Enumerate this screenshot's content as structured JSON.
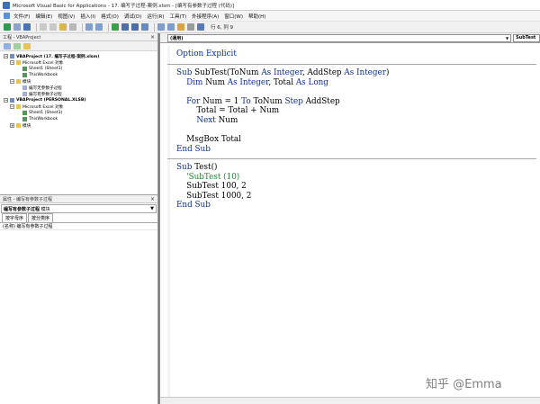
{
  "window": {
    "title": "Microsoft Visual Basic for Applications - 17. 编写子过程-案例.xlsm - [编写有参数子过程 (代码)]"
  },
  "menu": [
    "文件(F)",
    "编辑(E)",
    "视图(V)",
    "插入(I)",
    "格式(O)",
    "调试(D)",
    "运行(R)",
    "工具(T)",
    "外接程序(A)",
    "窗口(W)",
    "帮助(H)"
  ],
  "toolbar": {
    "cursor_position": "行 6, 列 9"
  },
  "project": {
    "panel_title": "工程 - VBAProject",
    "close_glyph": "×",
    "tree": [
      {
        "label": "VBAProject (17. 编写子过程-案例.xlsm)",
        "level": 0,
        "expander": "−",
        "icon": "project-icon",
        "bold": true
      },
      {
        "label": "Microsoft Excel 对象",
        "level": 1,
        "expander": "−",
        "icon": "folder-icon",
        "bold": false
      },
      {
        "label": "Sheet1 (Sheet1)",
        "level": 2,
        "expander": "",
        "icon": "sheet-icon",
        "bold": false
      },
      {
        "label": "ThisWorkbook",
        "level": 2,
        "expander": "",
        "icon": "sheet-icon",
        "bold": false
      },
      {
        "label": "模块",
        "level": 1,
        "expander": "−",
        "icon": "folder-icon",
        "bold": false
      },
      {
        "label": "编写无参数子过程",
        "level": 2,
        "expander": "",
        "icon": "module-icon",
        "bold": false
      },
      {
        "label": "编写有参数子过程",
        "level": 2,
        "expander": "",
        "icon": "module-icon",
        "bold": false
      },
      {
        "label": "VBAProject (PERSONAL.XLSB)",
        "level": 0,
        "expander": "−",
        "icon": "project-icon",
        "bold": true
      },
      {
        "label": "Microsoft Excel 对象",
        "level": 1,
        "expander": "−",
        "icon": "folder-icon",
        "bold": false
      },
      {
        "label": "Sheet1 (Sheet1)",
        "level": 2,
        "expander": "",
        "icon": "sheet-icon",
        "bold": false
      },
      {
        "label": "ThisWorkbook",
        "level": 2,
        "expander": "",
        "icon": "sheet-icon",
        "bold": false
      },
      {
        "label": "模块",
        "level": 1,
        "expander": "+",
        "icon": "folder-icon",
        "bold": false
      }
    ]
  },
  "properties": {
    "panel_title": "属性 - 编写有参数子过程",
    "close_glyph": "×",
    "object_name": "编写有参数子过程",
    "object_type": "模块",
    "tabs": [
      "按字母序",
      "按分类序"
    ],
    "rows": [
      "(名称) 编写有参数子过程"
    ]
  },
  "code": {
    "object_combo": "(通用)",
    "proc_combo": "SubTest",
    "dropdown_glyph": "▼",
    "section1": [
      [
        {
          "t": "Option Explicit",
          "c": "kw"
        }
      ]
    ],
    "section2": [
      [
        {
          "t": "Sub ",
          "c": "kw"
        },
        {
          "t": "SubTest(ToNum ",
          "c": ""
        },
        {
          "t": "As Integer",
          "c": "kw"
        },
        {
          "t": ", AddStep ",
          "c": ""
        },
        {
          "t": "As Integer",
          "c": "kw"
        },
        {
          "t": ")",
          "c": ""
        }
      ],
      [
        {
          "t": "    Dim ",
          "c": "kw"
        },
        {
          "t": "Num ",
          "c": ""
        },
        {
          "t": "As Integer",
          "c": "kw"
        },
        {
          "t": ", Total ",
          "c": ""
        },
        {
          "t": "As Long",
          "c": "kw"
        }
      ],
      [
        {
          "t": "",
          "c": ""
        }
      ],
      [
        {
          "t": "    For ",
          "c": "kw"
        },
        {
          "t": "Num = 1 ",
          "c": ""
        },
        {
          "t": "To ",
          "c": "kw"
        },
        {
          "t": "ToNum ",
          "c": ""
        },
        {
          "t": "Step ",
          "c": "kw"
        },
        {
          "t": "AddStep",
          "c": ""
        }
      ],
      [
        {
          "t": "        Total = Total + Num",
          "c": ""
        }
      ],
      [
        {
          "t": "        Next ",
          "c": "kw"
        },
        {
          "t": "Num",
          "c": ""
        }
      ],
      [
        {
          "t": "",
          "c": ""
        }
      ],
      [
        {
          "t": "    MsgBox Total",
          "c": ""
        }
      ],
      [
        {
          "t": "End Sub",
          "c": "kw"
        }
      ]
    ],
    "section3": [
      [
        {
          "t": "Sub ",
          "c": "kw"
        },
        {
          "t": "Test()",
          "c": ""
        }
      ],
      [
        {
          "t": "    'SubTest (10)",
          "c": "cm"
        }
      ],
      [
        {
          "t": "    SubTest 100, 2",
          "c": ""
        }
      ],
      [
        {
          "t": "    SubTest 1000, 2",
          "c": ""
        }
      ],
      [
        {
          "t": "End Sub",
          "c": "kw"
        }
      ]
    ]
  },
  "watermark": "知乎 @Emma",
  "colors": {
    "keyword": "#0f2f8f",
    "comment": "#1f8a33",
    "project_icon": "#6a8fc8",
    "folder_icon": "#e7c35a",
    "sheet_icon": "#4f9a57",
    "module_icon": "#9ab0d8"
  }
}
